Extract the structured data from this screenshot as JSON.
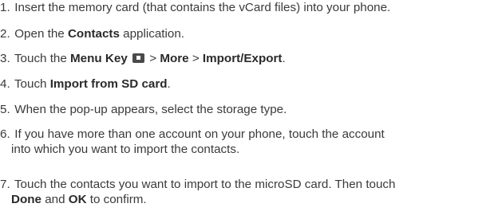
{
  "steps": [
    {
      "number": "1.",
      "text": "Insert the memory card (that contains the vCard files) into your phone."
    },
    {
      "number": "2.",
      "pre": "Open the ",
      "bold": "Contacts",
      "post": " application."
    },
    {
      "number": "3.",
      "pre": "Touch the ",
      "bold_menu_key": "Menu Key",
      "icon": "menu-key-icon",
      "sep1": " > ",
      "bold_more": "More",
      "sep2": " > ",
      "bold_import_export": "Import/Export",
      "post": "."
    },
    {
      "number": "4.",
      "pre": "Touch ",
      "bold": "Import from SD card",
      "post": "."
    },
    {
      "number": "5.",
      "text": "When the pop-up appears, select the storage type."
    },
    {
      "number": "6.",
      "line1": "If you have more than one account on your phone, touch the account",
      "line2": "into which you want to import the contacts."
    },
    {
      "number": "7.",
      "line1": "Touch the contacts you want to import to the microSD card. Then touch",
      "bold_done": "Done",
      "mid": " and ",
      "bold_ok": "OK",
      "post": " to confirm."
    }
  ]
}
